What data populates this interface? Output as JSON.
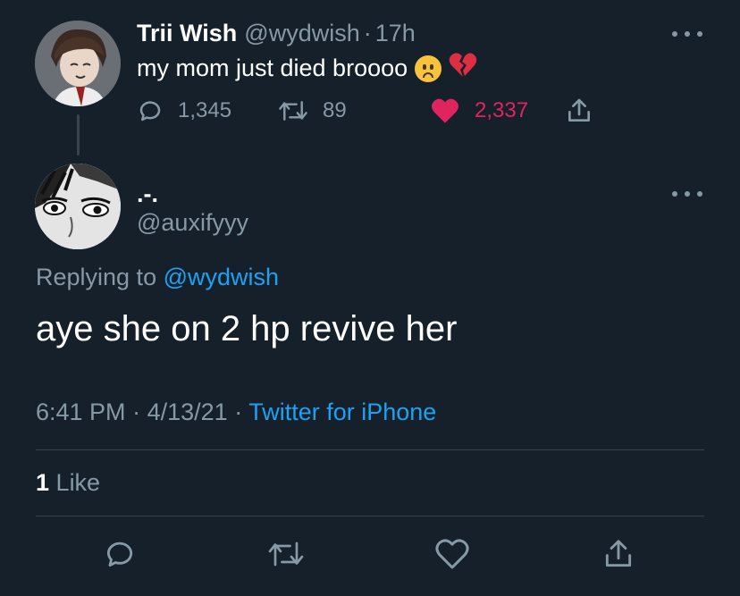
{
  "parent_tweet": {
    "display_name": "Trii Wish",
    "handle": "@wydwish",
    "separator": "·",
    "time": "17h",
    "text": "my mom just died broooo",
    "emoji_1": "frown-face",
    "emoji_2": "💔",
    "reply_count": "1,345",
    "retweet_count": "89",
    "like_count": "2,337",
    "liked": true
  },
  "main_tweet": {
    "display_name": ".-.",
    "handle": "@auxifyyy",
    "replying_prefix": "Replying to",
    "replying_handle": "@wydwish",
    "text": "aye she on 2 hp revive her",
    "time": "6:41 PM",
    "separator_1": "·",
    "date": "4/13/21",
    "separator_2": "·",
    "source": "Twitter for iPhone",
    "like_count": "1",
    "like_label": "Like"
  },
  "colors": {
    "background": "#15202b",
    "muted": "#8899a6",
    "accent": "#1da1f2",
    "like": "#e0245e",
    "divider": "#38444d"
  },
  "icons": {
    "reply": "reply-icon",
    "retweet": "retweet-icon",
    "like": "heart-icon",
    "share": "share-icon",
    "more": "more-icon"
  }
}
